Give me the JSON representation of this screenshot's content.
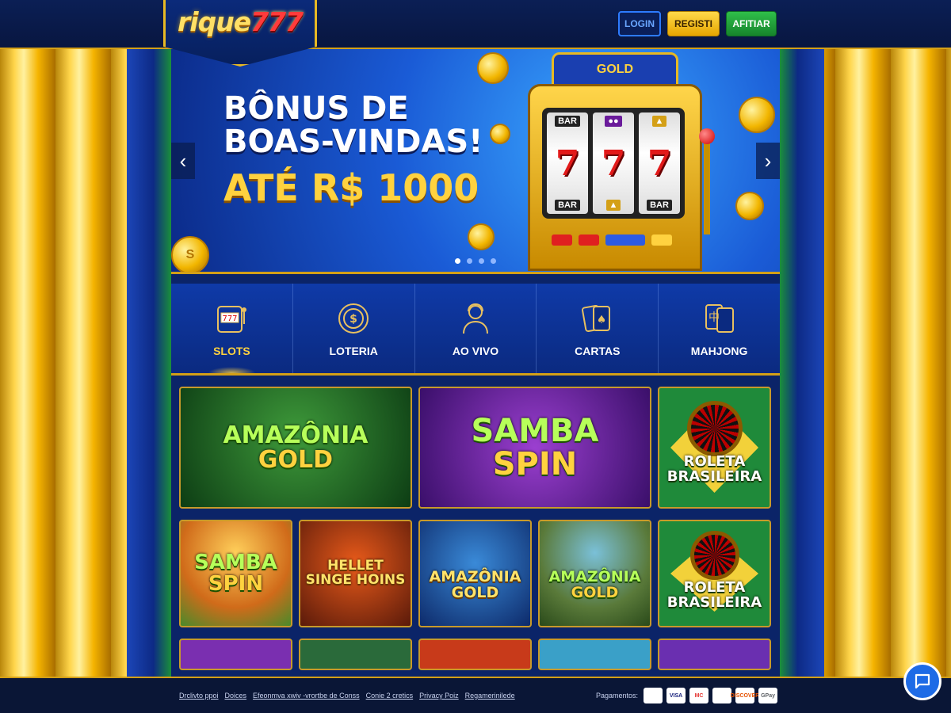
{
  "header": {
    "logo_word": "rique",
    "logo_num": "777",
    "login": "LOGIN",
    "register": "REGISTI",
    "affiliate": "AFITIAR"
  },
  "banner": {
    "line1": "BÔNUS DE",
    "line2": "BOAS-VINDAS!",
    "amount": "ATÉ R$ 1000",
    "slot_top": "GOLD",
    "reel_bar": "BAR",
    "reel_seven": "7",
    "coin_symbol": "S",
    "slides_total": 4,
    "slide_active": 1,
    "arrow_left": "‹",
    "arrow_right": "›"
  },
  "categories": [
    {
      "label": "SLOTS",
      "icon": "slot-machine-icon",
      "active": true
    },
    {
      "label": "LOTERIA",
      "icon": "coin-icon",
      "active": false
    },
    {
      "label": "AO VIVO",
      "icon": "dealer-icon",
      "active": false
    },
    {
      "label": "CARTAS",
      "icon": "cards-icon",
      "active": false
    },
    {
      "label": "MAHJONG",
      "icon": "mahjong-icon",
      "active": false
    }
  ],
  "games": {
    "row1": [
      {
        "line1": "AMAZÔNIA",
        "line2": "GOLD"
      },
      {
        "line1": "SAMBA",
        "line2": "SPIN"
      },
      {
        "line1": "ROLETA",
        "line2": "BRASILEIRA"
      }
    ],
    "row2": [
      {
        "line1": "SAMBA",
        "line2": "SPIN"
      },
      {
        "line1": "HELLET",
        "line2": "SINGE HOINS"
      },
      {
        "line1": "AMAZÔNIA",
        "line2": "GOLD"
      },
      {
        "line1": "AMAZÔNIA",
        "line2": "GOLD"
      },
      {
        "line1": "ROLETA",
        "line2": "BRASILEIRA"
      }
    ]
  },
  "footer": {
    "links": [
      "Drclivto ppoi",
      "Doices",
      "Efeonmva xwiv -vrortbe de Conss",
      "Conie 2 cretics",
      "Privacy Poiz",
      "Regamerinilede"
    ],
    "payments_label": "Pagamentos:",
    "payments": [
      "",
      "VISA",
      "MC",
      "",
      "DISCOVER",
      "GPay"
    ]
  }
}
